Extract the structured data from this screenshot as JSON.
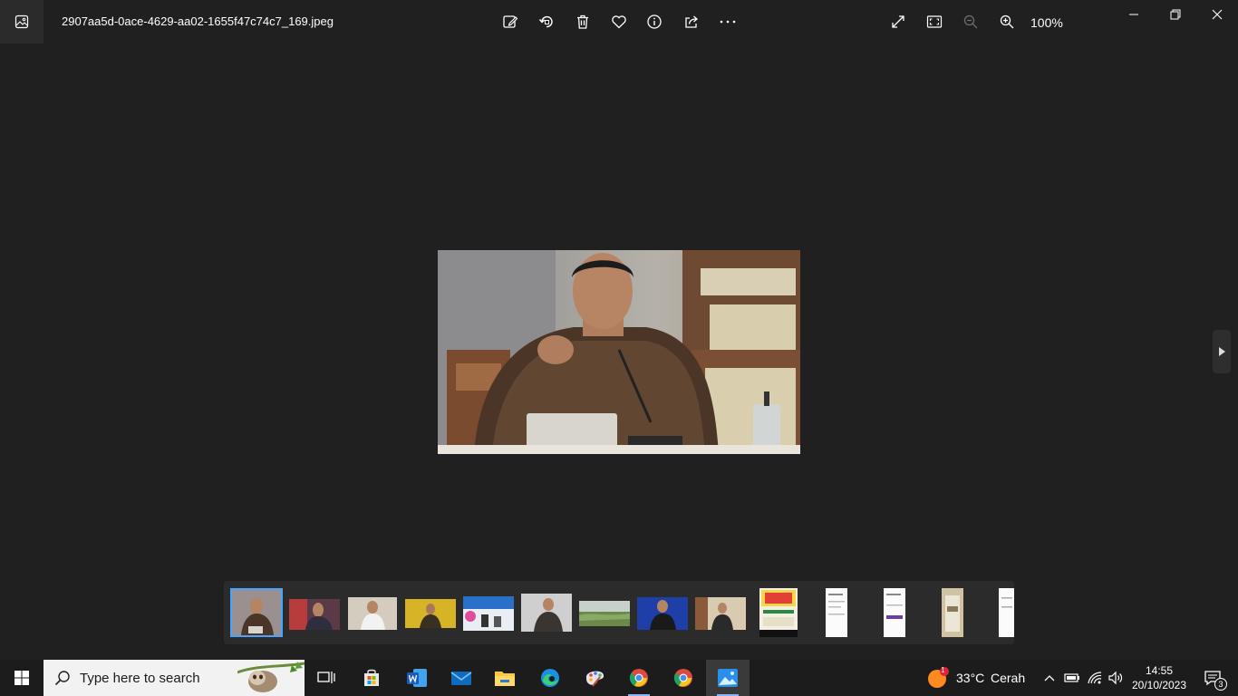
{
  "window": {
    "filename": "2907aa5d-0ace-4629-aa02-1655f47c74c7_169.jpeg",
    "zoom": "100%"
  },
  "toolbar": {
    "icons": [
      "edit-icon",
      "rotate-icon",
      "delete-icon",
      "favorite-icon",
      "info-icon",
      "share-icon",
      "more-icon"
    ],
    "right_icons": [
      "fullscreen-icon",
      "fit-window-icon",
      "zoom-out-icon",
      "zoom-in-icon"
    ]
  },
  "filmstrip": {
    "selected_index": 0,
    "thumb_count": 14
  },
  "taskbar": {
    "search_placeholder": "Type here to search",
    "weather_temp": "33°C",
    "weather_desc": "Cerah",
    "weather_badge": "1",
    "time": "14:55",
    "date": "20/10/2023",
    "notification_count": "3"
  },
  "colors": {
    "background": "#202020",
    "taskbar": "#1c1c1c",
    "accent": "#4aa3ff"
  }
}
